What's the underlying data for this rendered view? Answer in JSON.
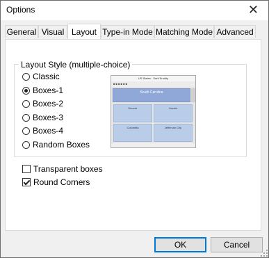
{
  "window": {
    "title": "Options"
  },
  "tabs": [
    {
      "label": "General"
    },
    {
      "label": "Visual"
    },
    {
      "label": "Layout"
    },
    {
      "label": "Type-in Mode"
    },
    {
      "label": "Matching Mode"
    },
    {
      "label": "Advanced"
    }
  ],
  "active_tab": "Layout",
  "layout_style": {
    "group_label": "Layout Style (multiple-choice)",
    "options": [
      {
        "label": "Classic",
        "checked": false
      },
      {
        "label": "Boxes-1",
        "checked": true
      },
      {
        "label": "Boxes-2",
        "checked": false
      },
      {
        "label": "Boxes-3",
        "checked": false
      },
      {
        "label": "Boxes-4",
        "checked": false
      },
      {
        "label": "Random Boxes",
        "checked": false
      }
    ]
  },
  "preview": {
    "title": "US States - Sarit Erudity",
    "header_cell": "South Carolina",
    "cells": [
      "Denver",
      "Lincoln",
      "Columbia",
      "Jefferson City"
    ]
  },
  "checkboxes": [
    {
      "label": "Transparent boxes",
      "checked": false
    },
    {
      "label": "Round Corners",
      "checked": true
    }
  ],
  "buttons": {
    "ok": "OK",
    "cancel": "Cancel"
  },
  "icons": {
    "close": "close-icon"
  }
}
